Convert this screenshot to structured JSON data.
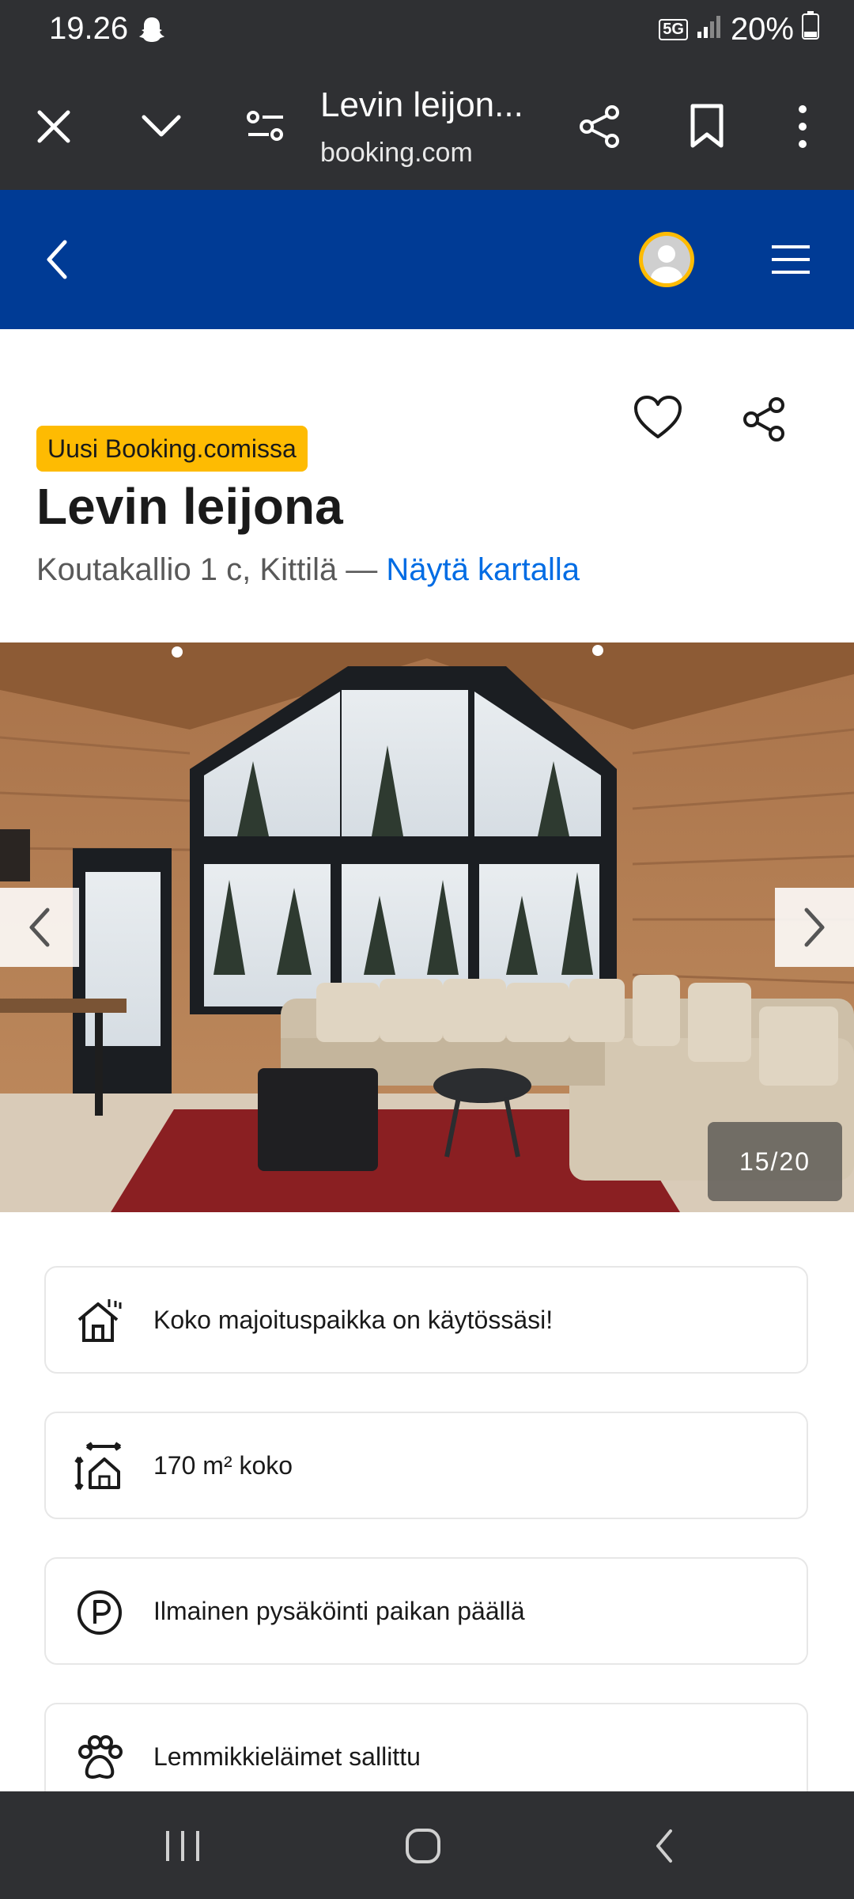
{
  "status_bar": {
    "time": "19.26",
    "network": "5G",
    "battery": "20%"
  },
  "browser": {
    "title": "Levin leijon...",
    "url": "booking.com"
  },
  "property": {
    "badge": "Uusi Booking.comissa",
    "name": "Levin leijona",
    "address": "Koutakallio 1 c, Kittilä — ",
    "map_link": "Näytä kartalla"
  },
  "gallery": {
    "counter": "15/20",
    "current_photo": 15,
    "total_photos": 20
  },
  "features": [
    {
      "label": "Koko majoituspaikka on käytössäsi!",
      "icon": "house-icon"
    },
    {
      "label": "170 m² koko",
      "icon": "size-icon"
    },
    {
      "label": "Ilmainen pysäköinti paikan päällä",
      "icon": "parking-icon"
    },
    {
      "label": "Lemmikkieläimet sallittu",
      "icon": "paw-icon"
    }
  ],
  "colors": {
    "brand_blue": "#003b95",
    "badge_yellow": "#febb02",
    "link_blue": "#006ce4",
    "system_bar": "#2f3033"
  }
}
